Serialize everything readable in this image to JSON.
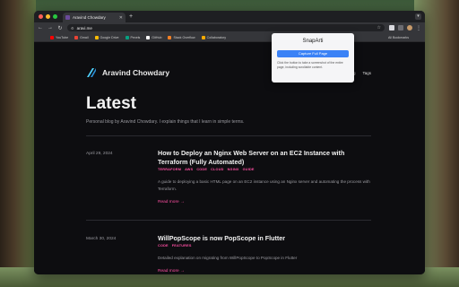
{
  "browser": {
    "tab_title": "Aravind Chowdary",
    "url": "aravi.me",
    "colors": {
      "close": "#ff5f57",
      "minimize": "#febc2e",
      "maximize": "#28c840"
    }
  },
  "bookmarks": {
    "items": [
      {
        "label": "YouTube",
        "color": "#ff0000"
      },
      {
        "label": "Gmail",
        "color": "#ea4335"
      },
      {
        "label": "Google Drive",
        "color": "#fbbc04"
      },
      {
        "label": "Pexels",
        "color": "#07a081"
      },
      {
        "label": "GitHub",
        "color": "#ffffff"
      },
      {
        "label": "Stack Overflow",
        "color": "#f48024"
      },
      {
        "label": "Collaboratory",
        "color": "#f9ab00"
      }
    ],
    "all_label": "All Bookmarks"
  },
  "site": {
    "name": "Aravind Chowdary",
    "nav": [
      "Blog",
      "Tags"
    ],
    "heading": "Latest",
    "subtitle": "Personal blog by Aravind Chowdary. I explain things that I learn in simple terms."
  },
  "posts": [
    {
      "date": "April 29, 2024",
      "title": "How to Deploy an Nginx Web Server on an EC2 Instance with Terraform (Fully Automated)",
      "tags": [
        "TERRAFORM",
        "AWS",
        "CODE",
        "CLOUD",
        "NGINX",
        "GUIDE"
      ],
      "description": "A guide to deploying a basic HTML page on an EC2 instance using an Nginx server and automating the process with Terraform.",
      "read_more": "Read more →"
    },
    {
      "date": "March 30, 2024",
      "title": "WillPopScope is now PopScope in Flutter",
      "tags": [
        "CODE",
        "FEATURES"
      ],
      "description": "Detailed explanation on migrating from WillPopScope to PopScope in Flutter",
      "read_more": "Read more →"
    }
  ],
  "extension_popup": {
    "title": "SnapArti",
    "button": "Capture Full Page",
    "note": "Click the button to take a screenshot of the entire page, including scrollable content."
  },
  "accent_color": "#ff4fa3"
}
